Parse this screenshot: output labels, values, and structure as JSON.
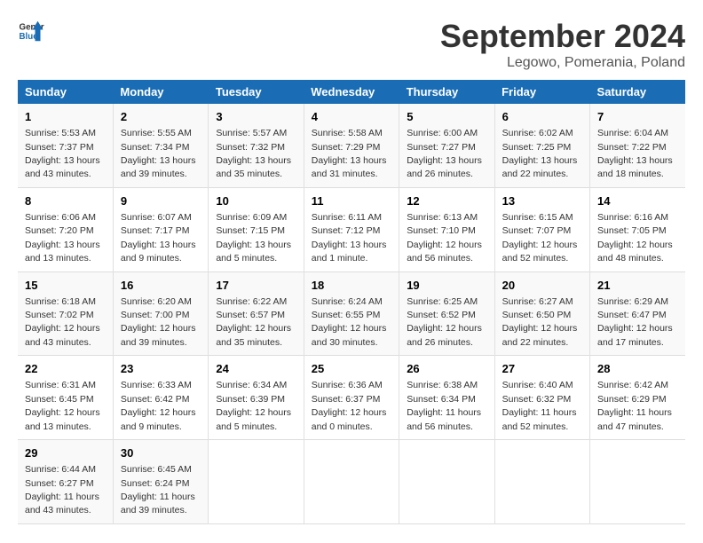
{
  "header": {
    "logo_line1": "General",
    "logo_line2": "Blue",
    "title": "September 2024",
    "subtitle": "Legowo, Pomerania, Poland"
  },
  "calendar": {
    "days_of_week": [
      "Sunday",
      "Monday",
      "Tuesday",
      "Wednesday",
      "Thursday",
      "Friday",
      "Saturday"
    ],
    "weeks": [
      [
        null,
        null,
        null,
        null,
        null,
        null,
        null
      ]
    ]
  },
  "weeks": [
    [
      {
        "num": "1",
        "sunrise": "Sunrise: 5:53 AM",
        "sunset": "Sunset: 7:37 PM",
        "daylight": "Daylight: 13 hours and 43 minutes."
      },
      {
        "num": "2",
        "sunrise": "Sunrise: 5:55 AM",
        "sunset": "Sunset: 7:34 PM",
        "daylight": "Daylight: 13 hours and 39 minutes."
      },
      {
        "num": "3",
        "sunrise": "Sunrise: 5:57 AM",
        "sunset": "Sunset: 7:32 PM",
        "daylight": "Daylight: 13 hours and 35 minutes."
      },
      {
        "num": "4",
        "sunrise": "Sunrise: 5:58 AM",
        "sunset": "Sunset: 7:29 PM",
        "daylight": "Daylight: 13 hours and 31 minutes."
      },
      {
        "num": "5",
        "sunrise": "Sunrise: 6:00 AM",
        "sunset": "Sunset: 7:27 PM",
        "daylight": "Daylight: 13 hours and 26 minutes."
      },
      {
        "num": "6",
        "sunrise": "Sunrise: 6:02 AM",
        "sunset": "Sunset: 7:25 PM",
        "daylight": "Daylight: 13 hours and 22 minutes."
      },
      {
        "num": "7",
        "sunrise": "Sunrise: 6:04 AM",
        "sunset": "Sunset: 7:22 PM",
        "daylight": "Daylight: 13 hours and 18 minutes."
      }
    ],
    [
      {
        "num": "8",
        "sunrise": "Sunrise: 6:06 AM",
        "sunset": "Sunset: 7:20 PM",
        "daylight": "Daylight: 13 hours and 13 minutes."
      },
      {
        "num": "9",
        "sunrise": "Sunrise: 6:07 AM",
        "sunset": "Sunset: 7:17 PM",
        "daylight": "Daylight: 13 hours and 9 minutes."
      },
      {
        "num": "10",
        "sunrise": "Sunrise: 6:09 AM",
        "sunset": "Sunset: 7:15 PM",
        "daylight": "Daylight: 13 hours and 5 minutes."
      },
      {
        "num": "11",
        "sunrise": "Sunrise: 6:11 AM",
        "sunset": "Sunset: 7:12 PM",
        "daylight": "Daylight: 13 hours and 1 minute."
      },
      {
        "num": "12",
        "sunrise": "Sunrise: 6:13 AM",
        "sunset": "Sunset: 7:10 PM",
        "daylight": "Daylight: 12 hours and 56 minutes."
      },
      {
        "num": "13",
        "sunrise": "Sunrise: 6:15 AM",
        "sunset": "Sunset: 7:07 PM",
        "daylight": "Daylight: 12 hours and 52 minutes."
      },
      {
        "num": "14",
        "sunrise": "Sunrise: 6:16 AM",
        "sunset": "Sunset: 7:05 PM",
        "daylight": "Daylight: 12 hours and 48 minutes."
      }
    ],
    [
      {
        "num": "15",
        "sunrise": "Sunrise: 6:18 AM",
        "sunset": "Sunset: 7:02 PM",
        "daylight": "Daylight: 12 hours and 43 minutes."
      },
      {
        "num": "16",
        "sunrise": "Sunrise: 6:20 AM",
        "sunset": "Sunset: 7:00 PM",
        "daylight": "Daylight: 12 hours and 39 minutes."
      },
      {
        "num": "17",
        "sunrise": "Sunrise: 6:22 AM",
        "sunset": "Sunset: 6:57 PM",
        "daylight": "Daylight: 12 hours and 35 minutes."
      },
      {
        "num": "18",
        "sunrise": "Sunrise: 6:24 AM",
        "sunset": "Sunset: 6:55 PM",
        "daylight": "Daylight: 12 hours and 30 minutes."
      },
      {
        "num": "19",
        "sunrise": "Sunrise: 6:25 AM",
        "sunset": "Sunset: 6:52 PM",
        "daylight": "Daylight: 12 hours and 26 minutes."
      },
      {
        "num": "20",
        "sunrise": "Sunrise: 6:27 AM",
        "sunset": "Sunset: 6:50 PM",
        "daylight": "Daylight: 12 hours and 22 minutes."
      },
      {
        "num": "21",
        "sunrise": "Sunrise: 6:29 AM",
        "sunset": "Sunset: 6:47 PM",
        "daylight": "Daylight: 12 hours and 17 minutes."
      }
    ],
    [
      {
        "num": "22",
        "sunrise": "Sunrise: 6:31 AM",
        "sunset": "Sunset: 6:45 PM",
        "daylight": "Daylight: 12 hours and 13 minutes."
      },
      {
        "num": "23",
        "sunrise": "Sunrise: 6:33 AM",
        "sunset": "Sunset: 6:42 PM",
        "daylight": "Daylight: 12 hours and 9 minutes."
      },
      {
        "num": "24",
        "sunrise": "Sunrise: 6:34 AM",
        "sunset": "Sunset: 6:39 PM",
        "daylight": "Daylight: 12 hours and 5 minutes."
      },
      {
        "num": "25",
        "sunrise": "Sunrise: 6:36 AM",
        "sunset": "Sunset: 6:37 PM",
        "daylight": "Daylight: 12 hours and 0 minutes."
      },
      {
        "num": "26",
        "sunrise": "Sunrise: 6:38 AM",
        "sunset": "Sunset: 6:34 PM",
        "daylight": "Daylight: 11 hours and 56 minutes."
      },
      {
        "num": "27",
        "sunrise": "Sunrise: 6:40 AM",
        "sunset": "Sunset: 6:32 PM",
        "daylight": "Daylight: 11 hours and 52 minutes."
      },
      {
        "num": "28",
        "sunrise": "Sunrise: 6:42 AM",
        "sunset": "Sunset: 6:29 PM",
        "daylight": "Daylight: 11 hours and 47 minutes."
      }
    ],
    [
      {
        "num": "29",
        "sunrise": "Sunrise: 6:44 AM",
        "sunset": "Sunset: 6:27 PM",
        "daylight": "Daylight: 11 hours and 43 minutes."
      },
      {
        "num": "30",
        "sunrise": "Sunrise: 6:45 AM",
        "sunset": "Sunset: 6:24 PM",
        "daylight": "Daylight: 11 hours and 39 minutes."
      },
      null,
      null,
      null,
      null,
      null
    ]
  ],
  "days_of_week": [
    "Sunday",
    "Monday",
    "Tuesday",
    "Wednesday",
    "Thursday",
    "Friday",
    "Saturday"
  ]
}
